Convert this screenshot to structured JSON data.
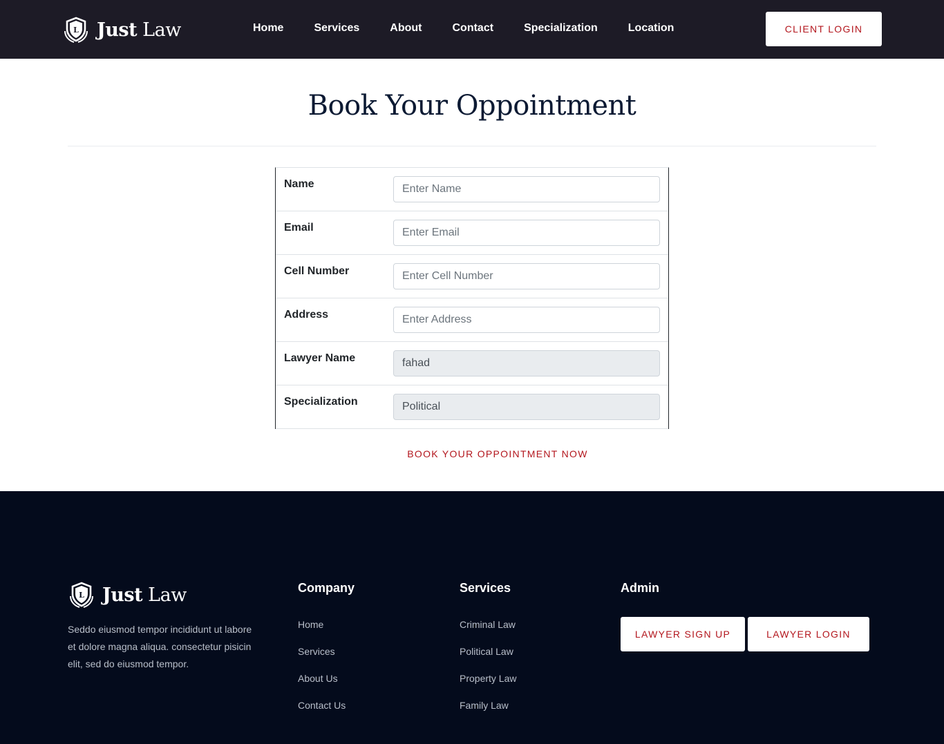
{
  "header": {
    "logo": {
      "word1": "Just",
      "word2": "Law",
      "emblem_letter": "L"
    },
    "nav": [
      "Home",
      "Services",
      "About",
      "Contact",
      "Specialization",
      "Location"
    ],
    "client_login": "CLIENT LOGIN"
  },
  "main": {
    "title": "Book Your Oppointment",
    "fields": [
      {
        "label": "Name",
        "placeholder": "Enter Name",
        "value": ""
      },
      {
        "label": "Email",
        "placeholder": "Enter Email",
        "value": ""
      },
      {
        "label": "Cell Number",
        "placeholder": "Enter Cell Number",
        "value": ""
      },
      {
        "label": "Address",
        "placeholder": "Enter Address",
        "value": ""
      },
      {
        "label": "Lawyer Name",
        "placeholder": "",
        "value": "fahad"
      },
      {
        "label": "Specialization",
        "placeholder": "",
        "value": "Political"
      }
    ],
    "submit_label": "BOOK YOUR OPPOINTMENT NOW"
  },
  "footer": {
    "logo": {
      "word1": "Just",
      "word2": "Law",
      "emblem_letter": "L"
    },
    "about": "Seddo eiusmod tempor incididunt ut labore et dolore magna aliqua. consectetur pisicin elit, sed do eiusmod tempor.",
    "company": {
      "title": "Company",
      "links": [
        "Home",
        "Services",
        "About Us",
        "Contact Us"
      ]
    },
    "services": {
      "title": "Services",
      "links": [
        "Criminal Law",
        "Political Law",
        "Property Law",
        "Family Law"
      ]
    },
    "admin": {
      "title": "Admin",
      "signup_label": "LAWYER SIGN UP",
      "login_label": "LAWYER LOGIN"
    }
  },
  "colors": {
    "header_bg": "#1d1b26",
    "footer_bg": "#040b1c",
    "accent": "#b3161d",
    "title": "#0c1a33"
  },
  "icons": {
    "logo_emblem": "shield-laurel-icon"
  }
}
